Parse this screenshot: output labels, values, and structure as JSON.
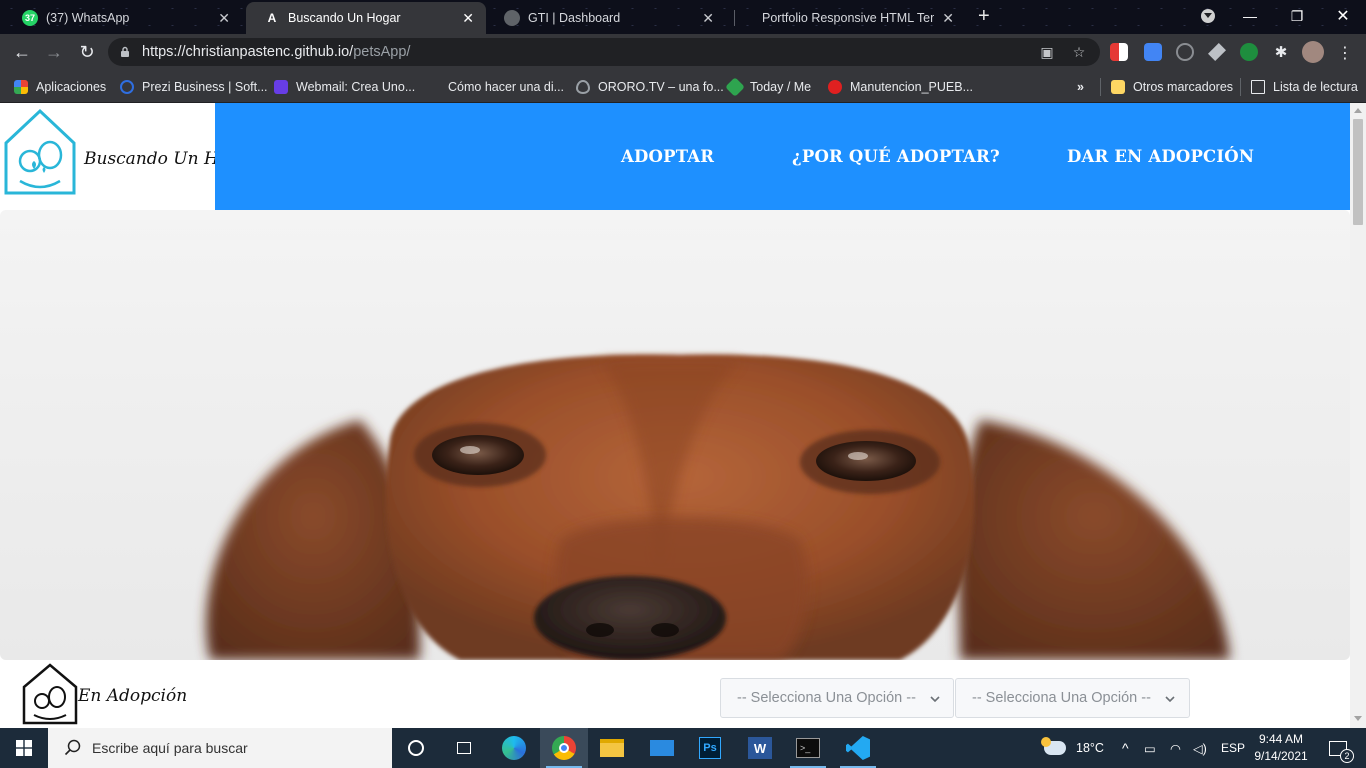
{
  "browser": {
    "tabs": [
      {
        "title": "(37) WhatsApp",
        "favicon_text": "37",
        "favicon_color": "#25d366",
        "active": false
      },
      {
        "title": "Buscando Un Hogar",
        "favicon_text": "A",
        "favicon_color": "#35363a",
        "active": true
      },
      {
        "title": "GTI | Dashboard",
        "favicon_text": "",
        "favicon_color": "#5f6368",
        "active": false
      },
      {
        "title": "Portfolio Responsive HTML Temp",
        "favicon_text": "",
        "favicon_color": "",
        "active": false
      }
    ],
    "url_host": "https://christianpastenc.github.io/",
    "url_path": "petsApp/",
    "bookmarks": [
      {
        "label": "Aplicaciones",
        "icon": "apps-grid-icon",
        "color": "#ea4335"
      },
      {
        "label": "Prezi Business | Soft...",
        "icon": "prezi-icon",
        "color": "#2f6ee0"
      },
      {
        "label": "Webmail: Crea Uno...",
        "icon": "hostinger-icon",
        "color": "#673de6"
      },
      {
        "label": "Cómo hacer una di...",
        "icon": "",
        "color": ""
      },
      {
        "label": "ORORO.TV – una fo...",
        "icon": "ororo-icon",
        "color": "#9aa0a6"
      },
      {
        "label": "Today / Me",
        "icon": "today-icon",
        "color": "#2ea44f"
      },
      {
        "label": "Manutencion_PUEB...",
        "icon": "red-dot-icon",
        "color": "#e02020"
      }
    ],
    "bookmarks_overflow": "»",
    "other_bookmarks": "Otros marcadores",
    "reading_list": "Lista de lectura"
  },
  "site": {
    "brand": "Buscando Un Hogar",
    "nav": [
      "ADOPTAR",
      "¿POR QUÉ ADOPTAR?",
      "DAR EN ADOPCIÓN"
    ],
    "nav_color": "#1e90ff",
    "section_brand": "En Adopción",
    "select_1": "-- Selecciona Una Opción --",
    "select_2": "-- Selecciona Una Opción --",
    "hero_image": "dachshund-photo"
  },
  "taskbar": {
    "search_placeholder": "Escribe aquí para buscar",
    "weather": "18°C",
    "language": "ESP",
    "time": "9:44 AM",
    "date": "9/14/2021",
    "notifications": "2"
  }
}
